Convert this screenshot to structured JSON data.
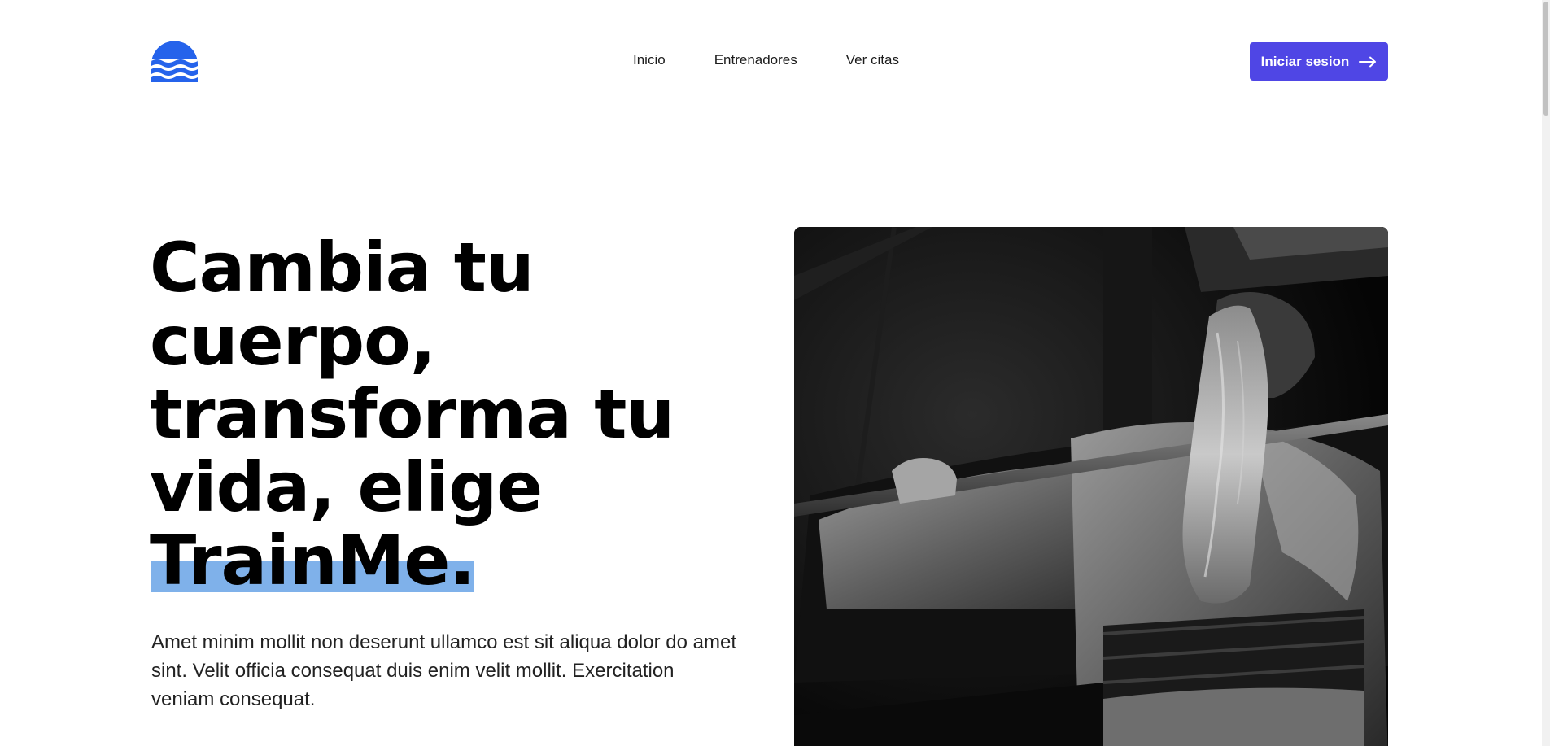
{
  "header": {
    "nav": [
      {
        "label": "Inicio"
      },
      {
        "label": "Entrenadores"
      },
      {
        "label": "Ver citas"
      }
    ],
    "login_label": "Iniciar sesion",
    "logo_icon": "waves-logo-icon",
    "accent_color": "#4f46e5",
    "logo_color": "#2563eb"
  },
  "hero": {
    "title_line_1": "Cambia tu",
    "title_line_2": "cuerpo,",
    "title_line_3": "transforma tu",
    "title_line_4": "vida, elige",
    "title_highlight": "TrainMe.",
    "highlight_color": "#7fb1ea",
    "description": "Amet minim mollit non deserunt ullamco est sit aliqua dolor do amet sint. Velit officia consequat duis enim velit mollit. Exercitation veniam consequat."
  }
}
